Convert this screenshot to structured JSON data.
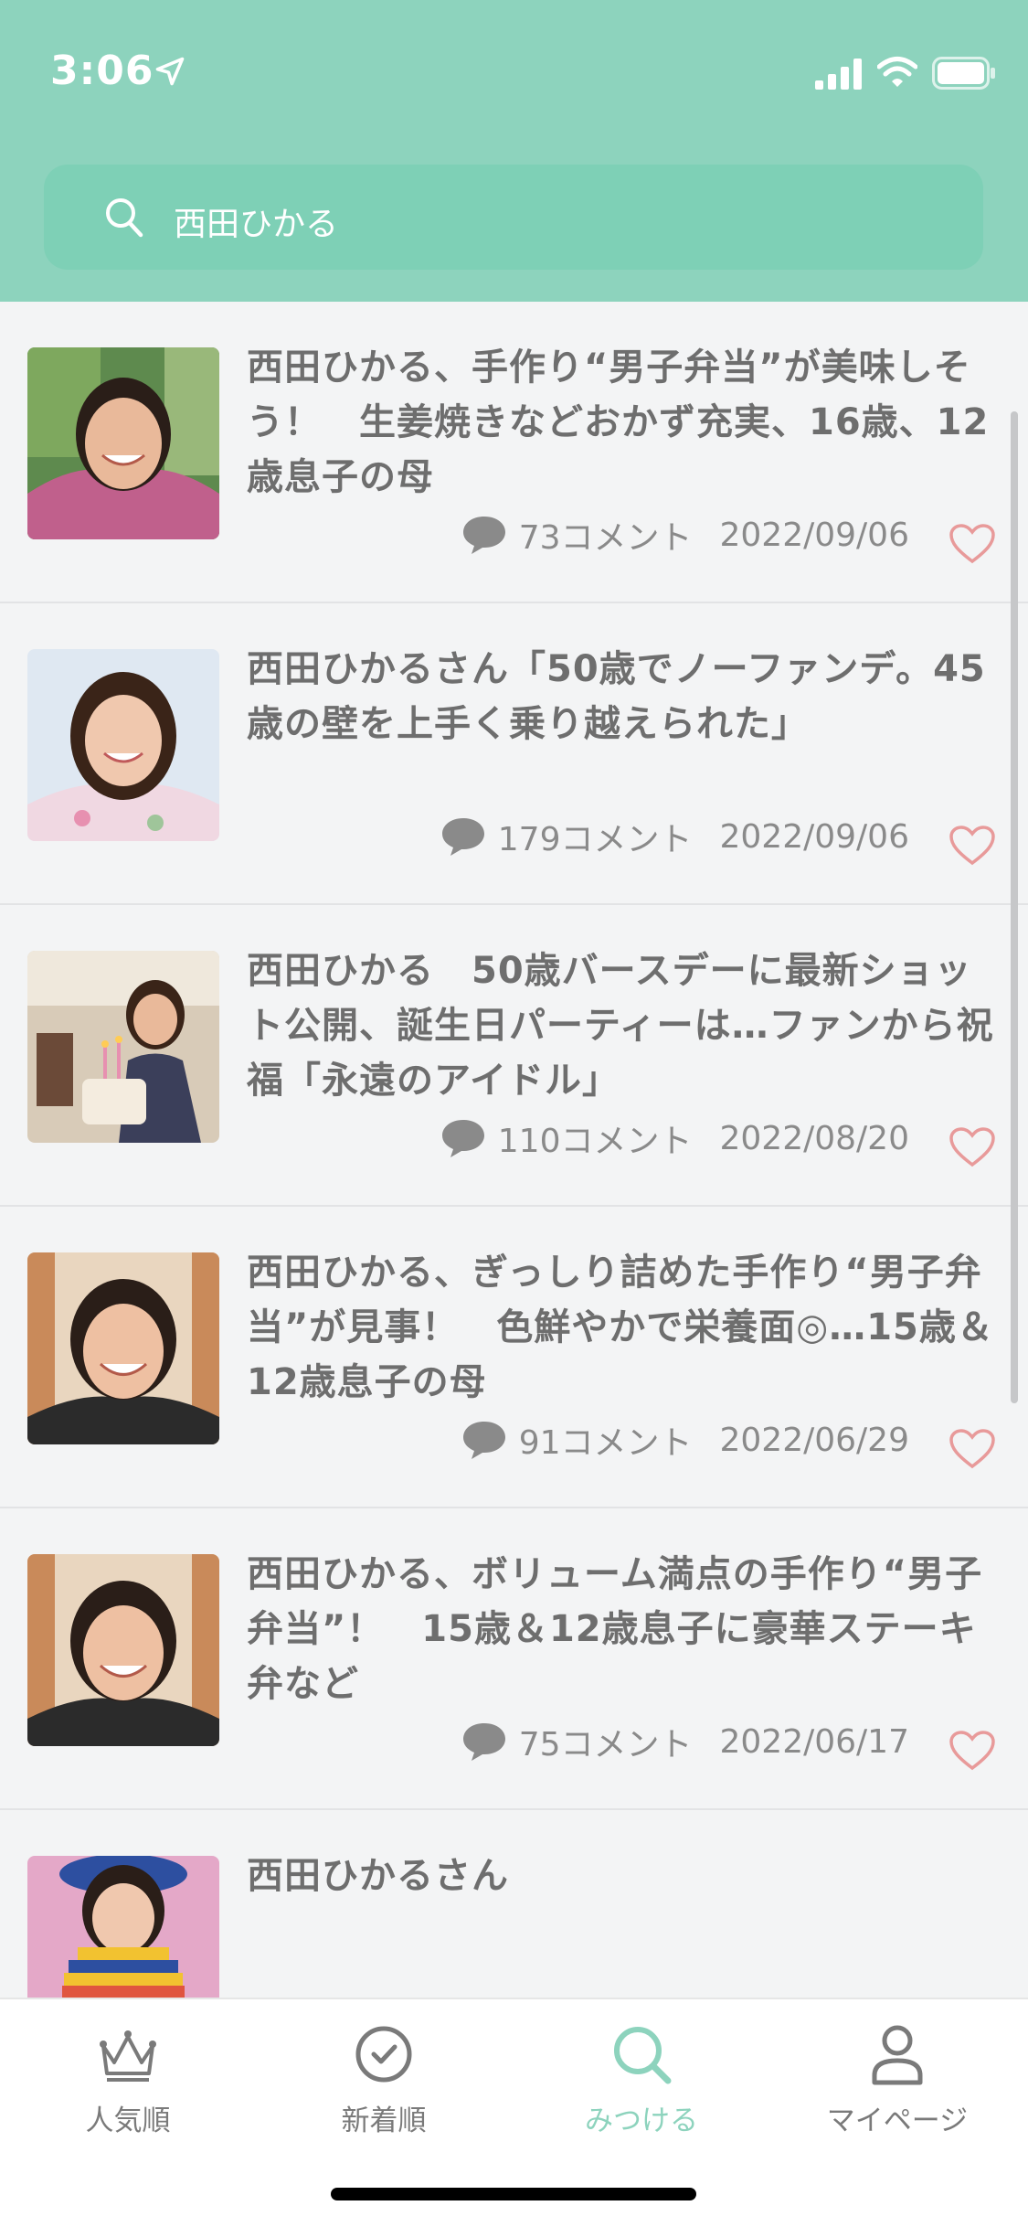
{
  "status_bar": {
    "time": "3:06"
  },
  "search": {
    "query": "西田ひかる"
  },
  "colors": {
    "accent": "#8dd3bd",
    "heart": "#e89a9a",
    "text": "#6e6e6e"
  },
  "articles": [
    {
      "title": "西田ひかる、手作り“男子弁当”が美味しそう！　生姜焼きなどおかず充実、16歳、12歳息子の母",
      "comments": "73コメント",
      "date": "2022/09/06"
    },
    {
      "title": "西田ひかるさん「50歳でノーファンデ。45歳の壁を上手く乗り越えられた」",
      "comments": "179コメント",
      "date": "2022/09/06"
    },
    {
      "title": "西田ひかる　50歳バースデーに最新ショット公開、誕生日パーティーは…ファンから祝福「永遠のアイドル」",
      "comments": "110コメント",
      "date": "2022/08/20"
    },
    {
      "title": "西田ひかる、ぎっしり詰めた手作り“男子弁当”が見事！　色鮮やかで栄養面◎…15歳＆12歳息子の母",
      "comments": "91コメント",
      "date": "2022/06/29"
    },
    {
      "title": "西田ひかる、ボリューム満点の手作り“男子弁当”！　15歳＆12歳息子に豪華ステーキ弁など",
      "comments": "75コメント",
      "date": "2022/06/17"
    },
    {
      "title": "西田ひかるさん"
    }
  ],
  "tabs": [
    {
      "label": "人気順",
      "icon": "crown-icon"
    },
    {
      "label": "新着順",
      "icon": "clock-icon"
    },
    {
      "label": "みつける",
      "icon": "search-icon"
    },
    {
      "label": "マイページ",
      "icon": "person-icon"
    }
  ]
}
